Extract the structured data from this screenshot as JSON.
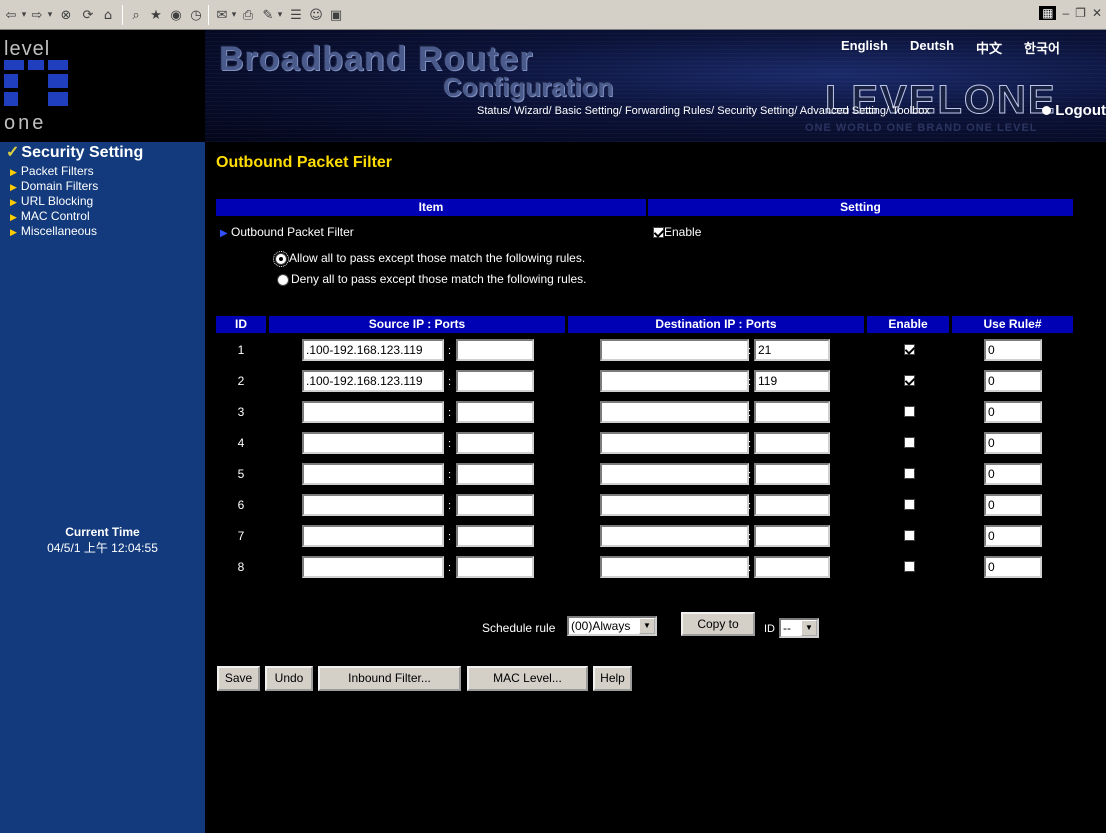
{
  "header": {
    "title_main": "Broadband Router",
    "title_sub": "Configuration",
    "brand": "LEVELONE",
    "tagline": "ONE WORLD ONE BRAND ONE LEVEL",
    "languages": [
      "English",
      "Deutsh",
      "中文",
      "한국어"
    ],
    "nav": "Status/ Wizard/ Basic Setting/ Forwarding Rules/ Security Setting/ Advanced Setting/ Toolbox",
    "logout": "Logout"
  },
  "left_logo": {
    "top": "level",
    "bottom": "one"
  },
  "sidebar": {
    "section_title": "Security Setting",
    "items": [
      "Packet Filters",
      "Domain Filters",
      "URL Blocking",
      "MAC Control",
      "Miscellaneous"
    ],
    "current_time_label": "Current Time",
    "current_time_value": "04/5/1 上午 12:04:55"
  },
  "main": {
    "page_title": "Outbound Packet Filter",
    "item_header": "Item",
    "setting_header": "Setting",
    "filter_label": "Outbound Packet Filter",
    "enable_label": "Enable",
    "enable_checked": true,
    "allow_label": "Allow all to pass except those match the following rules.",
    "deny_label": "Deny all to pass except those match the following rules.",
    "table_headers": {
      "id": "ID",
      "source": "Source IP : Ports",
      "dest": "Destination IP : Ports",
      "enable": "Enable",
      "use_rule": "Use Rule#"
    },
    "rows": [
      {
        "id": "1",
        "src_ip": ".100-192.168.123.119",
        "src_port": "",
        "dst_ip": "",
        "dst_port": "21",
        "enabled": true,
        "rule": "0"
      },
      {
        "id": "2",
        "src_ip": ".100-192.168.123.119",
        "src_port": "",
        "dst_ip": "",
        "dst_port": "119",
        "enabled": true,
        "rule": "0"
      },
      {
        "id": "3",
        "src_ip": "",
        "src_port": "",
        "dst_ip": "",
        "dst_port": "",
        "enabled": false,
        "rule": "0"
      },
      {
        "id": "4",
        "src_ip": "",
        "src_port": "",
        "dst_ip": "",
        "dst_port": "",
        "enabled": false,
        "rule": "0"
      },
      {
        "id": "5",
        "src_ip": "",
        "src_port": "",
        "dst_ip": "",
        "dst_port": "",
        "enabled": false,
        "rule": "0"
      },
      {
        "id": "6",
        "src_ip": "",
        "src_port": "",
        "dst_ip": "",
        "dst_port": "",
        "enabled": false,
        "rule": "0"
      },
      {
        "id": "7",
        "src_ip": "",
        "src_port": "",
        "dst_ip": "",
        "dst_port": "",
        "enabled": false,
        "rule": "0"
      },
      {
        "id": "8",
        "src_ip": "",
        "src_port": "",
        "dst_ip": "",
        "dst_port": "",
        "enabled": false,
        "rule": "0"
      }
    ],
    "schedule_label": "Schedule rule",
    "schedule_value": "(00)Always",
    "copy_to_label": "Copy to",
    "id_label": "ID",
    "id_value": "--",
    "buttons": {
      "save": "Save",
      "undo": "Undo",
      "inbound": "Inbound Filter...",
      "mac": "MAC Level...",
      "help": "Help"
    }
  }
}
